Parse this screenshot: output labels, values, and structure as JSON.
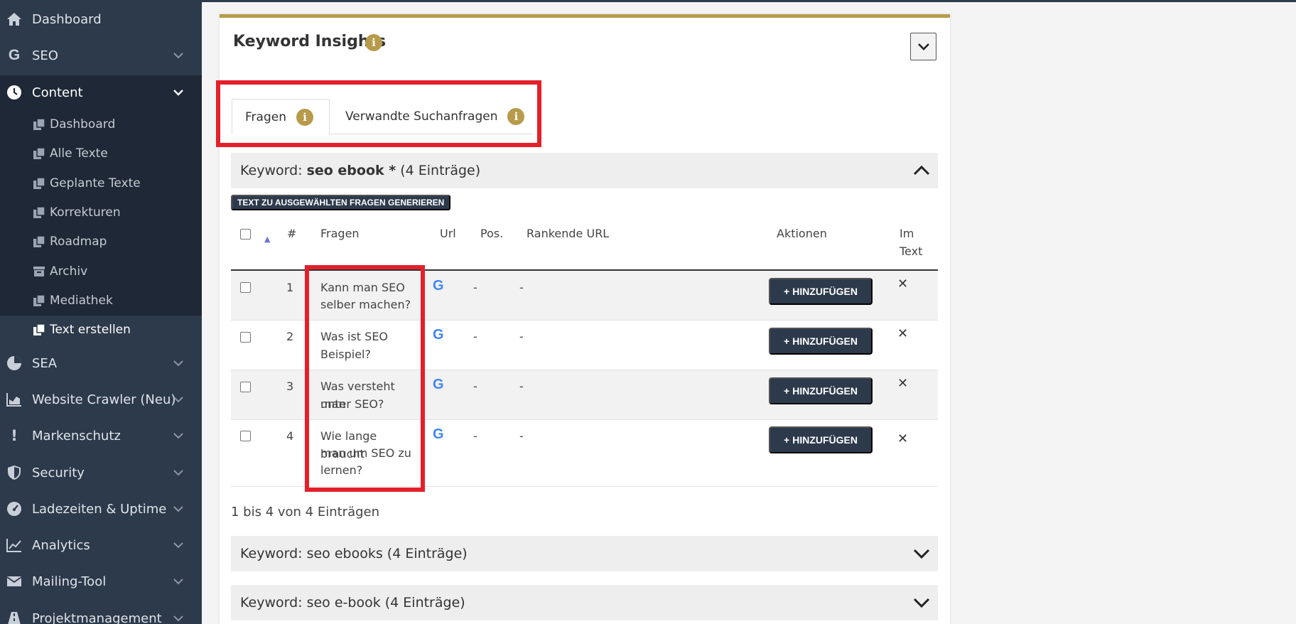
{
  "sidebar": {
    "items": [
      {
        "label": "Dashboard",
        "icon": "home-icon"
      },
      {
        "label": "SEO",
        "icon": "google-g-icon"
      },
      {
        "label": "Content",
        "icon": "clock-icon"
      },
      {
        "label": "SEA",
        "icon": "pie-chart-icon"
      },
      {
        "label": "Website Crawler (Neu)",
        "icon": "area-chart-icon"
      },
      {
        "label": "Markenschutz",
        "icon": "exclamation-icon"
      },
      {
        "label": "Security",
        "icon": "shield-icon"
      },
      {
        "label": "Ladezeiten & Uptime",
        "icon": "dashboard-gauge-icon"
      },
      {
        "label": "Analytics",
        "icon": "line-chart-icon"
      },
      {
        "label": "Mailing-Tool",
        "icon": "envelope-icon"
      },
      {
        "label": "Projektmanagement",
        "icon": "road-icon"
      }
    ],
    "content_sub": [
      {
        "label": "Dashboard",
        "icon": "copy-icon"
      },
      {
        "label": "Alle Texte",
        "icon": "copy-icon"
      },
      {
        "label": "Geplante Texte",
        "icon": "copy-icon"
      },
      {
        "label": "Korrekturen",
        "icon": "copy-icon"
      },
      {
        "label": "Roadmap",
        "icon": "copy-icon"
      },
      {
        "label": "Archiv",
        "icon": "archive-icon"
      },
      {
        "label": "Mediathek",
        "icon": "copy-icon"
      },
      {
        "label": "Text erstellen",
        "icon": "copy-icon"
      }
    ]
  },
  "card": {
    "title": "Keyword Insights",
    "info_glyph": "i"
  },
  "tabs": [
    {
      "label": "Fragen"
    },
    {
      "label": "Verwandte Suchanfragen"
    }
  ],
  "keyword_open": {
    "prefix": "Keyword:",
    "keyword": "seo ebook *",
    "suffix": "(4 Einträge)"
  },
  "generate_button": "TEXT ZU AUSGEWÄHLTEN FRAGEN GENERIEREN",
  "table": {
    "columns": {
      "sort": "▲",
      "num": "#",
      "fragen": "Fragen",
      "url": "Url",
      "pos": "Pos.",
      "rankende": "Rankende URL",
      "aktionen": "Aktionen",
      "im_text_1": "Im",
      "im_text_2": "Text"
    },
    "rows": [
      {
        "num": "1",
        "q1": "Kann man SEO",
        "q2": "selber machen?",
        "q3": "",
        "url_icon": "G",
        "pos": "-",
        "rankende": "-",
        "action": "HINZUFÜGEN",
        "im_text": "✕"
      },
      {
        "num": "2",
        "q1": "Was ist SEO",
        "q2": "Beispiel?",
        "q3": "",
        "url_icon": "G",
        "pos": "-",
        "rankende": "-",
        "action": "HINZUFÜGEN",
        "im_text": "✕"
      },
      {
        "num": "3",
        "q1": "Was versteht man",
        "q2": "unter SEO?",
        "q3": "",
        "url_icon": "G",
        "pos": "-",
        "rankende": "-",
        "action": "HINZUFÜGEN",
        "im_text": "✕"
      },
      {
        "num": "4",
        "q1": "Wie lange braucht",
        "q2": "man um SEO zu",
        "q3": "lernen?",
        "url_icon": "G",
        "pos": "-",
        "rankende": "-",
        "action": "HINZUFÜGEN",
        "im_text": "✕"
      }
    ],
    "footer": "1 bis 4 von 4 Einträgen"
  },
  "keyword_collapsed": [
    {
      "label": "Keyword: seo ebooks (4 Einträge)"
    },
    {
      "label": "Keyword: seo e-book (4 Einträge)"
    }
  ],
  "colors": {
    "sidebar_bg": "#2d3a4b",
    "accent_gold": "#b79b4b",
    "highlight_red": "#e3202a",
    "button_dark": "#2d3a4b"
  }
}
